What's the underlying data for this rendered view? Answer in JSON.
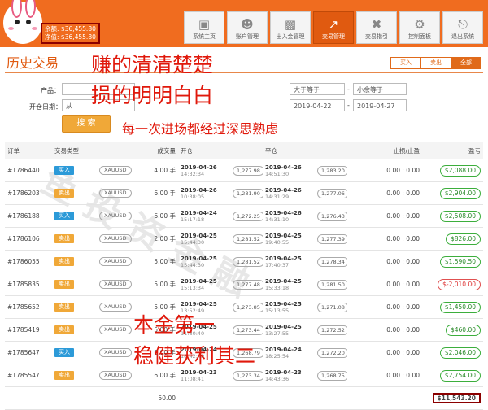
{
  "header": {
    "balance_label": "余额",
    "balance_value": "$36,455.80",
    "equity_label": "净值",
    "equity_value": "$36,455.80",
    "nav": [
      {
        "label": "系统主页",
        "icon": "monitor-icon"
      },
      {
        "label": "账户管理",
        "icon": "user-icon"
      },
      {
        "label": "出入金管理",
        "icon": "deposit-icon"
      },
      {
        "label": "交易管理",
        "icon": "chart-icon",
        "active": true
      },
      {
        "label": "交易指引",
        "icon": "tools-icon"
      },
      {
        "label": "控制面板",
        "icon": "gear-icon"
      },
      {
        "label": "退出系统",
        "icon": "logout-icon"
      }
    ]
  },
  "page": {
    "title": "历史交易",
    "filters": [
      "买入",
      "卖出",
      "全部"
    ],
    "active_filter": "全部"
  },
  "search": {
    "product_label": "产品：",
    "open_date_label": "开仓日期：",
    "open_from": "从",
    "close_from": "2019-04-22",
    "close_to": "2019-04-27",
    "ge_placeholder": "大于等于",
    "le_placeholder": "小余等于",
    "query_button": "搜 索"
  },
  "overlay": {
    "line1": "赚的清清楚楚",
    "line2": "损的明明白白",
    "line3": "每一次进场都经过深思熟虑",
    "line4": "本金第一",
    "line5": "稳健获利其二"
  },
  "table": {
    "headers": [
      "订单",
      "交易类型",
      "",
      "成交量",
      "开仓",
      "",
      "平仓",
      "",
      "止损/止盈",
      "盈亏"
    ],
    "rows": [
      {
        "order": "#1786440",
        "type": "买入",
        "side": "buy",
        "symbol": "XAUUSD",
        "volume": "4.00 手",
        "open_date": "2019-04-26",
        "open_time": "14:32:34",
        "open_price": "1,277.98",
        "close_date": "2019-04-26",
        "close_time": "14:51:30",
        "close_price": "1,283.20",
        "sltp": "0.00 : 0.00",
        "pnl": "$2,088.00"
      },
      {
        "order": "#1786203",
        "type": "卖出",
        "side": "sell",
        "symbol": "XAUUSD",
        "volume": "6.00 手",
        "open_date": "2019-04-26",
        "open_time": "10:38:05",
        "open_price": "1,281.90",
        "close_date": "2019-04-26",
        "close_time": "14:31:29",
        "close_price": "1,277.06",
        "sltp": "0.00 : 0.00",
        "pnl": "$2,904.00"
      },
      {
        "order": "#1786188",
        "type": "买入",
        "side": "buy",
        "symbol": "XAUUSD",
        "volume": "6.00 手",
        "open_date": "2019-04-24",
        "open_time": "15:17:18",
        "open_price": "1,272.25",
        "close_date": "2019-04-26",
        "close_time": "14:31:10",
        "close_price": "1,276.43",
        "sltp": "0.00 : 0.00",
        "pnl": "$2,508.00"
      },
      {
        "order": "#1786106",
        "type": "卖出",
        "side": "sell",
        "symbol": "XAUUSD",
        "volume": "2.00 手",
        "open_date": "2019-04-25",
        "open_time": "15:44:30",
        "open_price": "1,281.52",
        "close_date": "2019-04-25",
        "close_time": "19:40:55",
        "close_price": "1,277.39",
        "sltp": "0.00 : 0.00",
        "pnl": "$826.00"
      },
      {
        "order": "#1786055",
        "type": "卖出",
        "side": "sell",
        "symbol": "XAUUSD",
        "volume": "5.00 手",
        "open_date": "2019-04-25",
        "open_time": "15:44:30",
        "open_price": "1,281.52",
        "close_date": "2019-04-25",
        "close_time": "17:40:37",
        "close_price": "1,278.34",
        "sltp": "0.00 : 0.00",
        "pnl": "$1,590.50"
      },
      {
        "order": "#1785835",
        "type": "卖出",
        "side": "sell",
        "symbol": "XAUUSD",
        "volume": "5.00 手",
        "open_date": "2019-04-25",
        "open_time": "15:13:34",
        "open_price": "1,277.48",
        "close_date": "2019-04-25",
        "close_time": "15:33:18",
        "close_price": "1,281.50",
        "sltp": "0.00 : 0.00",
        "pnl": "$-2,010.00",
        "negative": true
      },
      {
        "order": "#1785652",
        "type": "卖出",
        "side": "sell",
        "symbol": "XAUUSD",
        "volume": "5.00 手",
        "open_date": "2019-04-25",
        "open_time": "13:52:49",
        "open_price": "1,273.85",
        "close_date": "2019-04-25",
        "close_time": "15:13:55",
        "close_price": "1,271.08",
        "sltp": "0.00 : 0.00",
        "pnl": "$1,450.00"
      },
      {
        "order": "#1785419",
        "type": "卖出",
        "side": "sell",
        "symbol": "XAUUSD",
        "volume": "5.00 手",
        "open_date": "2019-04-25",
        "open_time": "11:30:40",
        "open_price": "1,273.44",
        "close_date": "2019-04-25",
        "close_time": "13:27:55",
        "close_price": "1,272.52",
        "sltp": "0.00 : 0.00",
        "pnl": "$460.00"
      },
      {
        "order": "#1785647",
        "type": "买入",
        "side": "buy",
        "symbol": "XAUUSD",
        "volume": "6.00 手",
        "open_date": "2019-04-24",
        "open_time": "18:42:49",
        "open_price": "1,268.79",
        "close_date": "2019-04-24",
        "close_time": "18:25:54",
        "close_price": "1,272.20",
        "sltp": "0.00 : 0.00",
        "pnl": "$2,046.00"
      },
      {
        "order": "#1785547",
        "type": "卖出",
        "side": "sell",
        "symbol": "XAUUSD",
        "volume": "6.00 手",
        "open_date": "2019-04-23",
        "open_time": "11:08:41",
        "open_price": "1,273.34",
        "close_date": "2019-04-23",
        "close_time": "14:43:36",
        "close_price": "1,268.75",
        "sltp": "0.00 : 0.00",
        "pnl": "$2,754.00"
      }
    ],
    "total_volume": "50.00",
    "total_pnl": "$11,543.20"
  },
  "colors": {
    "header_bg": "#f06c1f",
    "accent": "#e05a10",
    "overlay_text": "#e0180b",
    "buy_tag": "#2c9ad8",
    "sell_tag": "#f0a838",
    "profit": "#2a8a2a",
    "loss": "#dd3333",
    "highlight_border": "#8b0000"
  }
}
